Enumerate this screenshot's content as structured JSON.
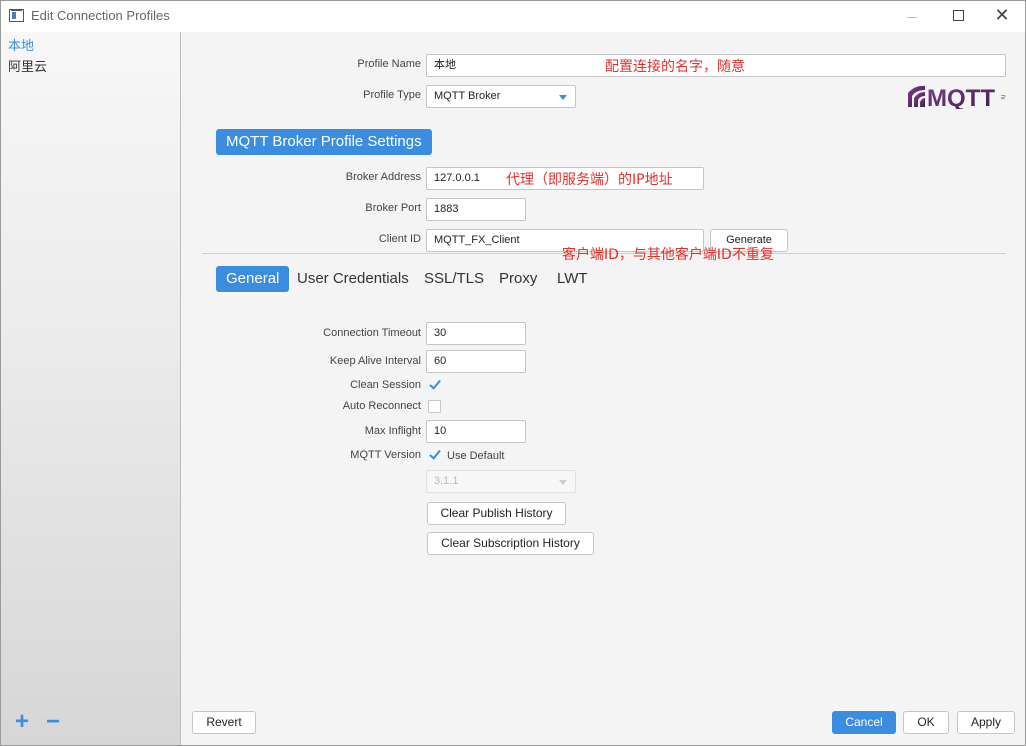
{
  "window": {
    "title": "Edit Connection Profiles"
  },
  "sidebar": {
    "profiles": [
      {
        "label": "本地",
        "active": true
      },
      {
        "label": "阿里云",
        "active": false
      }
    ],
    "add_icon": "plus-icon",
    "remove_icon": "minus-icon"
  },
  "profile": {
    "name_label": "Profile Name",
    "name_value": "本地",
    "name_annotation": "配置连接的名字，随意",
    "type_label": "Profile Type",
    "type_value": "MQTT Broker",
    "logo_text": "MQTT",
    "logo_subtext": "fx"
  },
  "broker": {
    "section_title": "MQTT Broker Profile Settings",
    "address_label": "Broker Address",
    "address_value": "127.0.0.1",
    "address_annotation": "代理（即服务端）的IP地址",
    "port_label": "Broker Port",
    "port_value": "1883",
    "client_id_label": "Client ID",
    "client_id_value": "MQTT_FX_Client",
    "generate_label": "Generate",
    "client_id_annotation": "客户端ID，与其他客户端ID不重复"
  },
  "tabs": [
    "General",
    "User Credentials",
    "SSL/TLS",
    "Proxy",
    "LWT"
  ],
  "general": {
    "connection_timeout_label": "Connection Timeout",
    "connection_timeout_value": "30",
    "keep_alive_label": "Keep Alive Interval",
    "keep_alive_value": "60",
    "clean_session_label": "Clean Session",
    "clean_session_checked": true,
    "auto_reconnect_label": "Auto Reconnect",
    "auto_reconnect_checked": false,
    "max_inflight_label": "Max Inflight",
    "max_inflight_value": "10",
    "mqtt_version_label": "MQTT Version",
    "use_default_label": "Use Default",
    "use_default_checked": true,
    "version_value": "3.1.1",
    "clear_publish_label": "Clear Publish History",
    "clear_subscription_label": "Clear Subscription History"
  },
  "footer": {
    "revert_label": "Revert",
    "cancel_label": "Cancel",
    "ok_label": "OK",
    "apply_label": "Apply"
  },
  "colors": {
    "accent": "#3b8de0",
    "annotation": "#e0322d"
  }
}
